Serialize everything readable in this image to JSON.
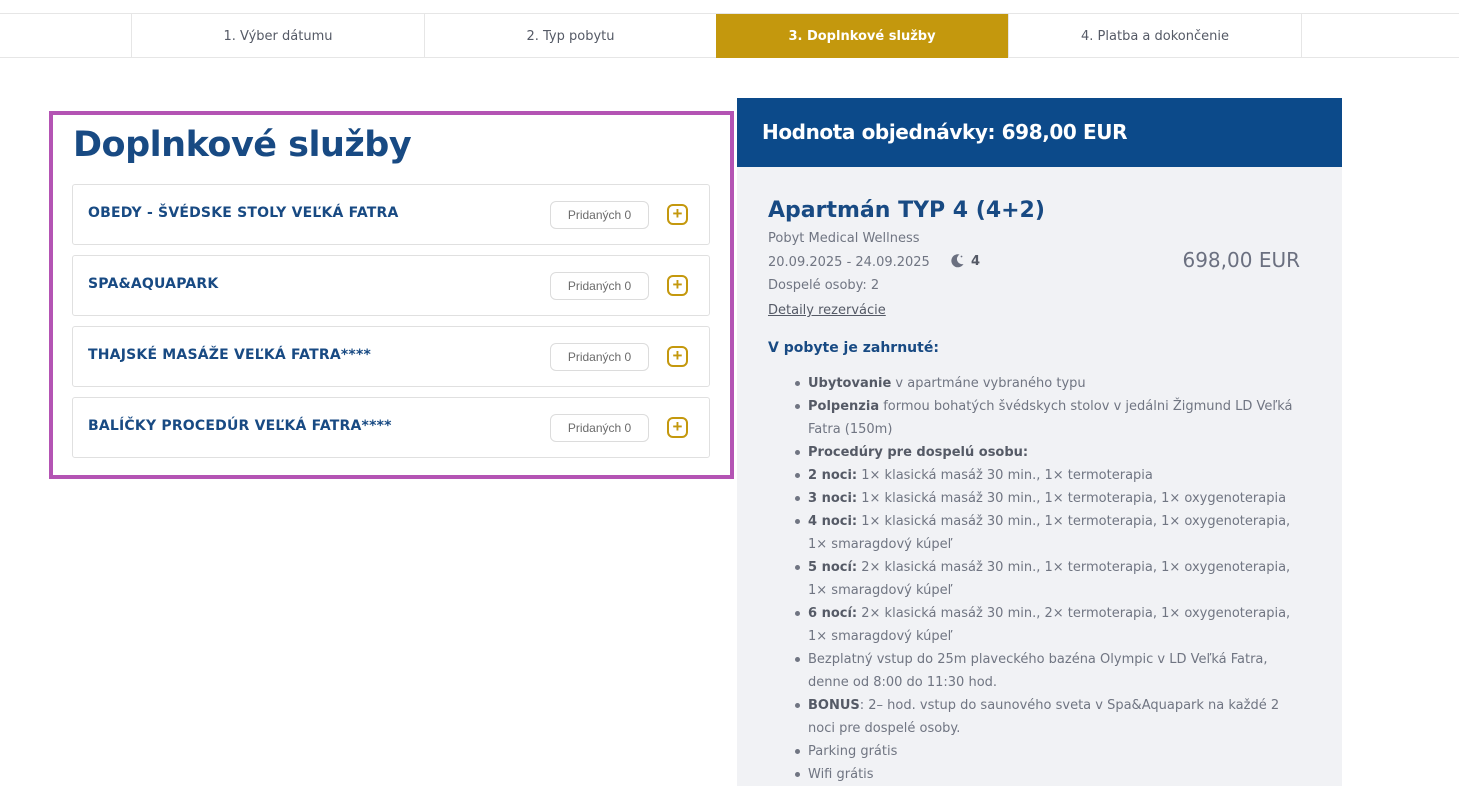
{
  "steps": [
    {
      "label": "1. Výber dátumu"
    },
    {
      "label": "2. Typ pobytu"
    },
    {
      "label": "3. Doplnkové služby",
      "active": true
    },
    {
      "label": "4. Platba a dokončenie"
    }
  ],
  "services": {
    "title": "Doplnkové služby",
    "items": [
      {
        "name": "OBEDY - ŠVÉDSKE STOLY VEĽKÁ FATRA",
        "added": "Pridaných 0"
      },
      {
        "name": "SPA&AQUAPARK",
        "added": "Pridaných 0"
      },
      {
        "name": "THAJSKÉ MASÁŽE VEĽKÁ FATRA****",
        "added": "Pridaných 0"
      },
      {
        "name": "BALÍČKY PROCEDÚR VEĽKÁ FATRA****",
        "added": "Pridaných 0"
      }
    ],
    "add_icon": "plus-icon"
  },
  "order": {
    "header": "Hodnota objednávky: 698,00 EUR",
    "apartment": "Apartmán TYP 4 (4+2)",
    "stay_type": "Pobyt Medical Wellness",
    "dates": "20.09.2025 - 24.09.2025",
    "nights": "4",
    "nights_icon": "moon-icon",
    "adults": "Dospelé osoby: 2",
    "price": "698,00 EUR",
    "details_link": "Detaily rezervácie",
    "included_title": "V pobyte je zahrnuté:",
    "included": [
      {
        "bold": "Ubytovanie",
        "text": " v apartmáne vybraného typu"
      },
      {
        "bold": "Polpenzia",
        "text": " formou bohatých švédskych stolov v jedálni Žigmund LD Veľká Fatra (150m)"
      },
      {
        "bold": "Procedúry pre dospelú osobu:",
        "text": ""
      },
      {
        "bold": "2 noci:",
        "text": " 1× klasická masáž 30 min., 1× termoterapia"
      },
      {
        "bold": "3 noci:",
        "text": " 1× klasická masáž 30 min., 1× termoterapia, 1× oxygenoterapia"
      },
      {
        "bold": "4 noci:",
        "text": " 1× klasická masáž 30 min., 1× termoterapia, 1× oxygenoterapia, 1× smaragdový kúpeľ"
      },
      {
        "bold": "5 nocí:",
        "text": " 2× klasická masáž 30 min., 1× termoterapia, 1× oxygenoterapia, 1× smaragdový kúpeľ"
      },
      {
        "bold": "6 nocí:",
        "text": " 2× klasická masáž 30 min., 2× termoterapia, 1× oxygenoterapia, 1× smaragdový kúpeľ"
      },
      {
        "bold": "",
        "text": "Bezplatný vstup do 25m plaveckého bazéna Olympic v LD Veľká Fatra, denne od 8:00 do 11:30 hod."
      },
      {
        "bold": "BONUS",
        "text": ": 2– hod. vstup do saunového sveta v Spa&Aquapark na každé 2 noci pre dospelé osoby."
      },
      {
        "bold": "",
        "text": "Parking grátis"
      },
      {
        "bold": "",
        "text": "Wifi grátis"
      }
    ]
  },
  "colors": {
    "accent": "#c4980d",
    "primary": "#0c4a8a",
    "highlight_border": "#b454b4"
  }
}
